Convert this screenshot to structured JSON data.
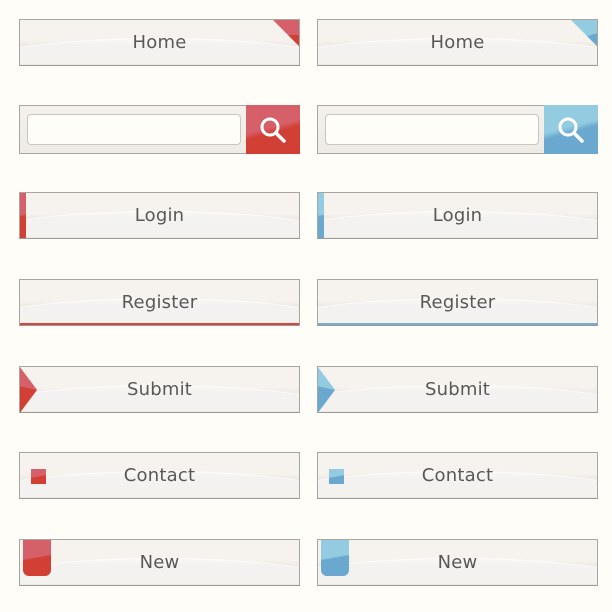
{
  "theme_colors": {
    "red": "#d23f35",
    "red_light": "#d6606a",
    "blue": "#6aa8cf",
    "blue_light": "#93cbe0",
    "background": "#fefdf8",
    "text": "#5a5856"
  },
  "buttons": {
    "home": "Home",
    "login": "Login",
    "register": "Register",
    "submit": "Submit",
    "contact": "Contact",
    "new": "New"
  },
  "search": {
    "value": "",
    "placeholder": "",
    "icon": "search-icon"
  },
  "variants": [
    "red",
    "blue"
  ]
}
